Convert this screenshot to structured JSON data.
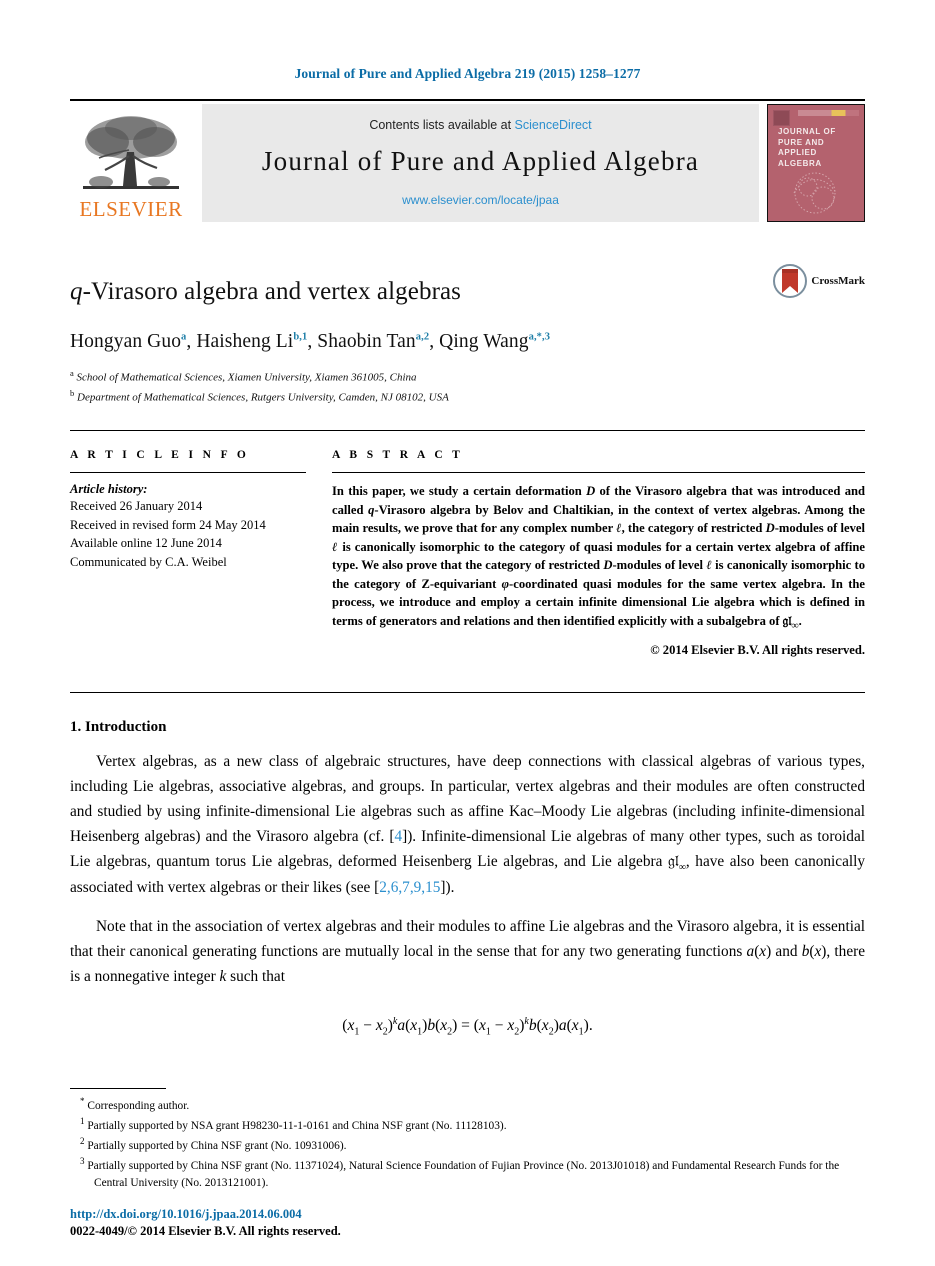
{
  "running_head": "Journal of Pure and Applied Algebra 219 (2015) 1258–1277",
  "masthead": {
    "publisher_name": "ELSEVIER",
    "contents_prefix": "Contents lists available at ",
    "sciencedirect_link": "ScienceDirect",
    "journal_name": "Journal of Pure and Applied Algebra",
    "journal_url": "www.elsevier.com/locate/jpaa",
    "cover_title": "JOURNAL OF PURE AND APPLIED ALGEBRA",
    "link_color": "#2b8fce",
    "cover_color": "#b4626e",
    "elsevier_orange": "#e87722"
  },
  "article": {
    "title_italic": "q",
    "title_rest": "-Virasoro algebra and vertex algebras",
    "crossmark_label": "CrossMark",
    "authors_html": "Hongyan Guo<sup>a</sup>, Haisheng Li<sup>b,1</sup>, Shaobin Tan<sup>a,2</sup>, Qing Wang<sup>a,*,3</sup>",
    "affiliations": [
      {
        "marker": "a",
        "text": "School of Mathematical Sciences, Xiamen University, Xiamen 361005, China"
      },
      {
        "marker": "b",
        "text": "Department of Mathematical Sciences, Rutgers University, Camden, NJ 08102, USA"
      }
    ]
  },
  "info": {
    "heading": "A R T I C L E   I N F O",
    "history_label": "Article history:",
    "history": [
      "Received 26 January 2014",
      "Received in revised form 24 May 2014",
      "Available online 12 June 2014",
      "Communicated by C.A. Weibel"
    ]
  },
  "abstract": {
    "heading": "A B S T R A C T",
    "text_html": "In this paper, we study a certain deformation <em>D</em> of the Virasoro algebra that was introduced and called <em>q</em>-Virasoro algebra by Belov and Chaltikian, in the context of vertex algebras. Among the main results, we prove that for any complex number <em>ℓ</em>, the category of restricted <em>D</em>-modules of level <em>ℓ</em> is canonically isomorphic to the category of quasi modules for a certain vertex algebra of affine type. We also prove that the category of restricted <em>D</em>-modules of level <em>ℓ</em> is canonically isomorphic to the category of Z-equivariant <em>φ</em>-coordinated quasi modules for the same vertex algebra. In the process, we introduce and employ a certain infinite dimensional Lie algebra which is defined in terms of generators and relations and then identified explicitly with a subalgebra of 𝔤𝔩<sub class=\"sm\">∞</sub>.",
    "copyright": "© 2014 Elsevier B.V. All rights reserved."
  },
  "body": {
    "section_title": "1. Introduction",
    "paragraph1_html": "Vertex algebras, as a new class of algebraic structures, have deep connections with classical algebras of various types, including Lie algebras, associative algebras, and groups. In particular, vertex algebras and their modules are often constructed and studied by using infinite-dimensional Lie algebras such as affine Kac–Moody Lie algebras (including infinite-dimensional Heisenberg algebras) and the Virasoro algebra (cf. [<span class=\"cite\">4</span>]). Infinite-dimensional Lie algebras of many other types, such as toroidal Lie algebras, quantum torus Lie algebras, deformed Heisenberg Lie algebras, and Lie algebra 𝔤𝔩<sub class=\"sm\">∞</sub>, have also been canonically associated with vertex algebras or their likes (see [<span class=\"cite\">2,6,7,9,15</span>]).",
    "paragraph2_html": "Note that in the association of vertex algebras and their modules to affine Lie algebras and the Virasoro algebra, it is essential that their canonical generating functions are mutually local in the sense that for any two generating functions <i>a</i>(<i>x</i>) and <i>b</i>(<i>x</i>), there is a nonnegative integer <i>k</i> such that",
    "equation_html": "(<i>x</i><sub class=\"sm\">1</sub> − <i>x</i><sub class=\"sm\">2</sub>)<sup class=\"sm\"><i>k</i></sup><i>a</i>(<i>x</i><sub class=\"sm\">1</sub>)<i>b</i>(<i>x</i><sub class=\"sm\">2</sub>) = (<i>x</i><sub class=\"sm\">1</sub> − <i>x</i><sub class=\"sm\">2</sub>)<sup class=\"sm\"><i>k</i></sup><i>b</i>(<i>x</i><sub class=\"sm\">2</sub>)<i>a</i>(<i>x</i><sub class=\"sm\">1</sub>)."
  },
  "footnotes": [
    {
      "marker": "*",
      "text": "Corresponding author."
    },
    {
      "marker": "1",
      "text": "Partially supported by NSA grant H98230-11-1-0161 and China NSF grant (No. 11128103)."
    },
    {
      "marker": "2",
      "text": "Partially supported by China NSF grant (No. 10931006)."
    },
    {
      "marker": "3",
      "text": "Partially supported by China NSF grant (No. 11371024), Natural Science Foundation of Fujian Province (No. 2013J01018) and Fundamental Research Funds for the Central University (No. 2013121001)."
    }
  ],
  "footer": {
    "doi": "http://dx.doi.org/10.1016/j.jpaa.2014.06.004",
    "issn": "0022-4049/© 2014 Elsevier B.V. All rights reserved."
  }
}
